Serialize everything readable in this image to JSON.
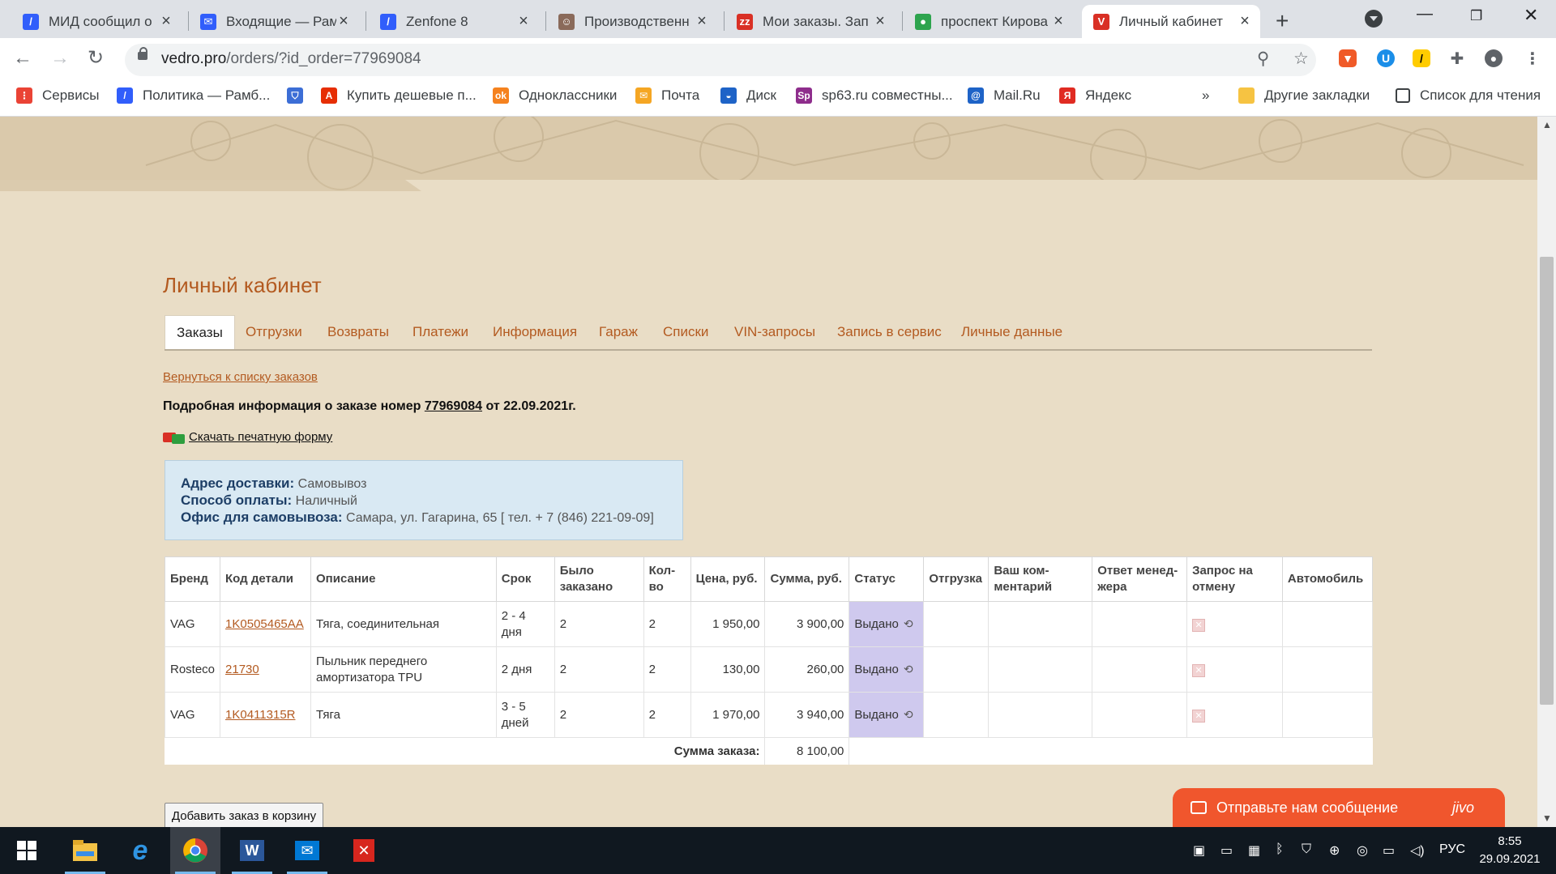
{
  "browser": {
    "tabs": [
      {
        "title": "МИД сообщил о",
        "icon": "rambler-icon",
        "color": "#315efb",
        "glyph": "/"
      },
      {
        "title": "Входящие — Рам",
        "icon": "mail-icon",
        "color": "#315efb",
        "glyph": "✉"
      },
      {
        "title": "Zenfone 8",
        "icon": "rambler-icon",
        "color": "#315efb",
        "glyph": "/"
      },
      {
        "title": "Производственн",
        "icon": "avatar-icon",
        "color": "#8a6a5a",
        "glyph": "☺"
      },
      {
        "title": "Мои заказы. Зап",
        "icon": "zz-icon",
        "color": "#d93025",
        "glyph": "zz"
      },
      {
        "title": "проспект Кирова",
        "icon": "map-pin-icon",
        "color": "#2da44e",
        "glyph": "●"
      },
      {
        "title": "Личный кабинет",
        "icon": "vedro-icon",
        "color": "#d93025",
        "glyph": "V"
      }
    ],
    "url_host": "vedro.pro",
    "url_path": "/orders/?id_order=77969084",
    "bookmarks": [
      {
        "label": "Сервисы",
        "icon": "apps-grid-icon",
        "color": "#ea4335",
        "glyph": "⋮"
      },
      {
        "label": "Политика — Рамб...",
        "icon": "rambler-icon",
        "color": "#315efb",
        "glyph": "/"
      },
      {
        "label": "",
        "icon": "shield-icon",
        "color": "#3c6ed6",
        "glyph": "⛉"
      },
      {
        "label": "Купить дешевые п...",
        "icon": "aliexpress-icon",
        "color": "#e62e04",
        "glyph": "A"
      },
      {
        "label": "Одноклассники",
        "icon": "ok-icon",
        "color": "#f5821f",
        "glyph": "ok"
      },
      {
        "label": "Почта",
        "icon": "mail-icon",
        "color": "#f5a623",
        "glyph": "✉"
      },
      {
        "label": "Диск",
        "icon": "disk-icon",
        "color": "#1e63c7",
        "glyph": "◒"
      },
      {
        "label": "sp63.ru совместны...",
        "icon": "sp63-icon",
        "color": "#8e2d8c",
        "glyph": "Sp"
      },
      {
        "label": "Mail.Ru",
        "icon": "mailru-icon",
        "color": "#1e63c7",
        "glyph": "@"
      },
      {
        "label": "Яндекс",
        "icon": "yandex-icon",
        "color": "#e02b22",
        "glyph": "Я"
      }
    ],
    "bookmarks_more": "»",
    "other_bookmarks": "Другие закладки",
    "reading_list": "Список для чтения"
  },
  "page": {
    "title": "Личный кабинет",
    "tabs": [
      "Заказы",
      "Отгрузки",
      "Возвраты",
      "Платежи",
      "Информация",
      "Гараж",
      "Списки",
      "VIN-запросы",
      "Запись в сервис",
      "Личные данные"
    ],
    "active_tab": "Заказы",
    "back_link": "Вернуться к списку заказов",
    "order_head_prefix": "Подробная информация о заказе номер",
    "order_number": "77969084",
    "order_head_suffix": "от 22.09.2021г.",
    "download_label": "Скачать печатную форму",
    "delivery": {
      "address_label": "Адрес доставки:",
      "address_value": "Самовывоз",
      "payment_label": "Способ оплаты:",
      "payment_value": "Наличный",
      "office_label": "Офис для самовывоза:",
      "office_value": "Самара, ул. Гагарина, 65 [ тел. + 7 (846) 221-09-09]"
    },
    "table": {
      "headers": [
        "Бренд",
        "Код детали",
        "Описание",
        "Срок",
        "Было заказано",
        "Кол-во",
        "Цена, руб.",
        "Сумма, руб.",
        "Статус",
        "Отгрузка",
        "Ваш ком-ментарий",
        "Ответ менед-жера",
        "Запрос на отмену",
        "Автомобиль"
      ],
      "rows": [
        {
          "brand": "VAG",
          "code": "1K0505465AA",
          "desc": "Тяга, соединительная",
          "term": "2 - 4 дня",
          "ordered": "2",
          "qty": "2",
          "price": "1 950,00",
          "sum": "3 900,00",
          "status": "Выдано"
        },
        {
          "brand": "Rosteco",
          "code": "21730",
          "desc": "Пыльник переднего амортизатора TPU",
          "term": "2 дня",
          "ordered": "2",
          "qty": "2",
          "price": "130,00",
          "sum": "260,00",
          "status": "Выдано"
        },
        {
          "brand": "VAG",
          "code": "1K0411315R",
          "desc": "Тяга",
          "term": "3 - 5 дней",
          "ordered": "2",
          "qty": "2",
          "price": "1 970,00",
          "sum": "3 940,00",
          "status": "Выдано"
        }
      ],
      "total_label": "Сумма заказа:",
      "total_value": "8 100,00"
    },
    "add_to_cart": "Добавить заказ в корзину"
  },
  "chat": {
    "label": "Отправьте нам сообщение",
    "brand": "jivo",
    "color": "#f0562d"
  },
  "taskbar": {
    "apps": [
      "start-icon",
      "file-explorer-icon",
      "internet-explorer-icon",
      "chrome-icon",
      "word-icon",
      "mail-icon",
      "acrobat-icon"
    ],
    "lang": "РУС",
    "time": "8:55",
    "date": "29.09.2021"
  },
  "colors": {
    "accent": "#b35a20",
    "status_bg": "#cfc9ee",
    "info_bg": "#d9e9f3"
  }
}
